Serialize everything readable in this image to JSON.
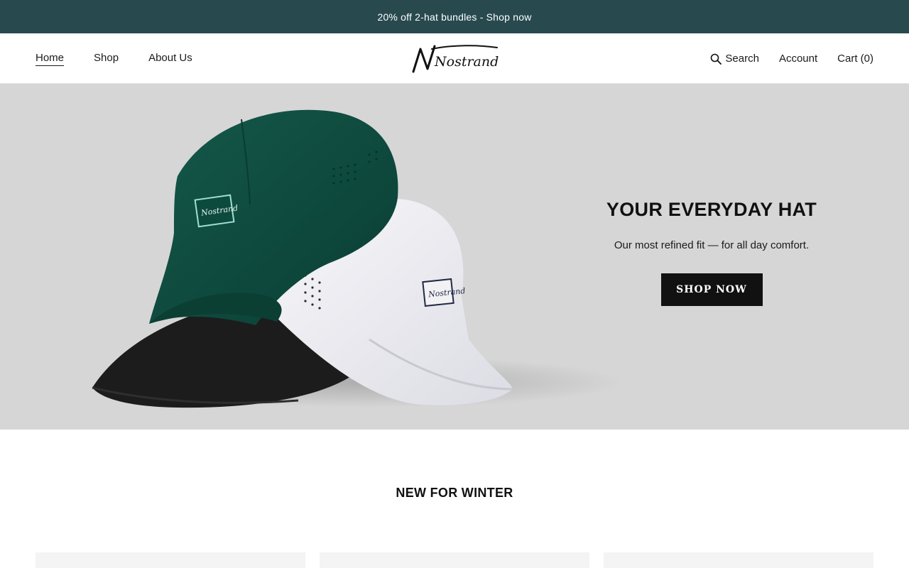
{
  "announcement": {
    "text": "20% off 2-hat bundles - Shop now"
  },
  "nav": {
    "left": [
      {
        "label": "Home",
        "active": true
      },
      {
        "label": "Shop",
        "active": false
      },
      {
        "label": "About Us",
        "active": false
      }
    ],
    "right": {
      "search_label": "Search",
      "account_label": "Account",
      "cart_label": "Cart (0)"
    }
  },
  "brand": {
    "logo_text": "Nostrand"
  },
  "hero": {
    "title": "YOUR EVERYDAY HAT",
    "subtitle": "Our most refined fit — for all day comfort.",
    "cta_label": "SHOP NOW",
    "background_color": "#d6d6d6",
    "hat_colors": [
      "#0e4a3e",
      "#ececf0",
      "#1c1c1c"
    ]
  },
  "section": {
    "title": "NEW FOR WINTER"
  },
  "colors": {
    "announcement_bg": "#284a4f",
    "button_bg": "#111111",
    "text": "#1a1a1a"
  },
  "icons": {
    "search": "search-icon"
  }
}
